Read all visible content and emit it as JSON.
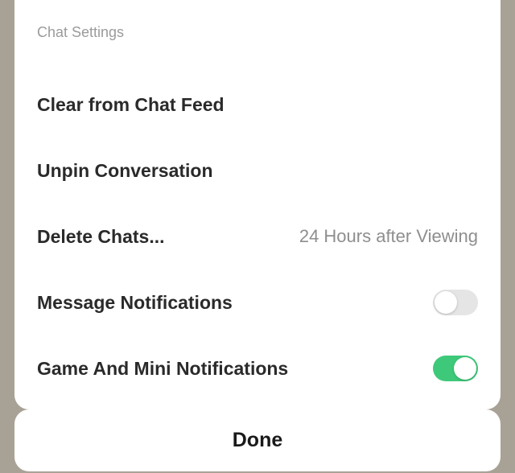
{
  "colors": {
    "toggle_on": "#3ec97a",
    "toggle_off": "#e5e5e5"
  },
  "sheet": {
    "title": "Chat Settings",
    "rows": {
      "clear": {
        "label": "Clear from Chat Feed"
      },
      "unpin": {
        "label": "Unpin Conversation"
      },
      "delete": {
        "label": "Delete Chats...",
        "value": "24 Hours after Viewing"
      },
      "msg_notif": {
        "label": "Message Notifications",
        "on": false
      },
      "game_notif": {
        "label": "Game And Mini Notifications",
        "on": true
      }
    }
  },
  "done": {
    "label": "Done"
  }
}
